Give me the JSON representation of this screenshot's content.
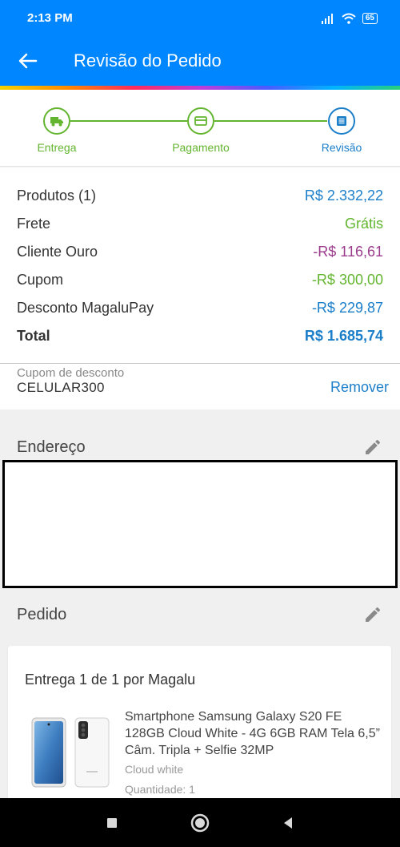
{
  "status_bar": {
    "time": "2:13 PM",
    "battery": "65"
  },
  "app_bar": {
    "title": "Revisão do Pedido",
    "back_icon": "arrow-left-icon"
  },
  "stepper": {
    "steps": [
      {
        "label": "Entrega",
        "icon": "truck-icon",
        "state": "done"
      },
      {
        "label": "Pagamento",
        "icon": "card-icon",
        "state": "done"
      },
      {
        "label": "Revisão",
        "icon": "document-icon",
        "state": "current"
      }
    ],
    "colors": {
      "done": "#63b52f",
      "current": "#1b7ec9"
    }
  },
  "summary": {
    "rows": [
      {
        "label": "Produtos (1)",
        "value": "R$ 2.332,22",
        "color": "#1b7ec9"
      },
      {
        "label": "Frete",
        "value": "Grátis",
        "color": "#63b52f"
      },
      {
        "label": "Cliente Ouro",
        "value": "-R$ 116,61",
        "color": "#9b3b8c"
      },
      {
        "label": "Cupom",
        "value": "-R$ 300,00",
        "color": "#63b52f"
      },
      {
        "label": "Desconto MagaluPay",
        "value": "-R$ 229,87",
        "color": "#1b7ec9"
      },
      {
        "label": "Total",
        "value": "R$ 1.685,74",
        "color": "#1b7ec9"
      }
    ]
  },
  "coupon": {
    "placeholder": "Cupom de desconto",
    "code": "CELULAR300",
    "remove_label": "Remover"
  },
  "address": {
    "title": "Endereço"
  },
  "order": {
    "title": "Pedido",
    "delivery_title": "Entrega 1 de 1 por Magalu",
    "product_name": "Smartphone Samsung Galaxy S20 FE 128GB Cloud White - 4G 6GB RAM Tela 6,5” Câm. Tripla + Selfie 32MP",
    "product_color": "Cloud white",
    "quantity": "Quantidade:  1"
  }
}
